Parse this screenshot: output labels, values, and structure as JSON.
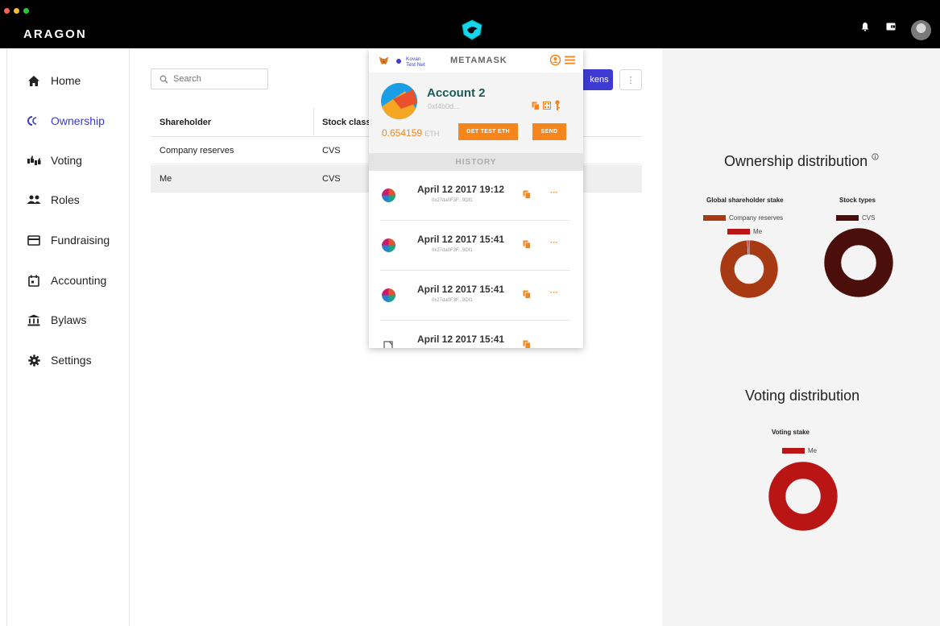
{
  "app": {
    "brand": "ARAGON"
  },
  "colors": {
    "accent": "#3d3bd1",
    "metamask_orange": "#f6851b",
    "company_reserves": "#a83a13",
    "me": "#b91515",
    "cvs": "#4a0f0a"
  },
  "topbar": {
    "icons": [
      "bell-icon",
      "wallet-icon",
      "avatar"
    ]
  },
  "sidebar": {
    "items": [
      {
        "label": "Home",
        "icon": "home-icon"
      },
      {
        "label": "Ownership",
        "icon": "ownership-icon"
      },
      {
        "label": "Voting",
        "icon": "voting-icon"
      },
      {
        "label": "Roles",
        "icon": "roles-icon"
      },
      {
        "label": "Fundraising",
        "icon": "fundraising-icon"
      },
      {
        "label": "Accounting",
        "icon": "accounting-icon"
      },
      {
        "label": "Bylaws",
        "icon": "bylaws-icon"
      },
      {
        "label": "Settings",
        "icon": "settings-icon"
      }
    ],
    "active": "Ownership"
  },
  "main": {
    "search": {
      "placeholder": "Search"
    },
    "tokens_button": "kens",
    "more_button": "⋮",
    "table": {
      "headers": [
        "Shareholder",
        "Stock class"
      ],
      "rows": [
        {
          "shareholder": "Company reserves",
          "stock_class": "CVS"
        },
        {
          "shareholder": "Me",
          "stock_class": "CVS"
        }
      ]
    }
  },
  "ownership": {
    "title": "Ownership distribution",
    "global_stake": {
      "title": "Global shareholder stake",
      "legend": [
        "Company reserves",
        "Me"
      ]
    },
    "stock_types": {
      "title": "Stock types",
      "legend": [
        "CVS"
      ]
    }
  },
  "voting": {
    "title": "Voting distribution",
    "stake": {
      "title": "Voting stake",
      "legend": [
        "Me"
      ]
    }
  },
  "chart_data": [
    {
      "type": "pie",
      "title": "Global shareholder stake",
      "categories": [
        "Company reserves",
        "Me"
      ],
      "values": [
        99,
        1
      ]
    },
    {
      "type": "pie",
      "title": "Stock types",
      "categories": [
        "CVS"
      ],
      "values": [
        100
      ]
    },
    {
      "type": "pie",
      "title": "Voting stake",
      "categories": [
        "Me"
      ],
      "values": [
        100
      ]
    }
  ],
  "metamask": {
    "network": [
      "Kovan",
      "Test Net"
    ],
    "title": "METAMASK",
    "account": {
      "name": "Account 2",
      "address": "0xf4b0d...",
      "balance": "0.654159",
      "unit": "ETH"
    },
    "buttons": {
      "get_test_eth": "GET TEST ETH",
      "send": "SEND"
    },
    "history_label": "HISTORY",
    "transactions": [
      {
        "date": "April 12 2017 19:12",
        "hash": "0x27da0F3F...9Df1"
      },
      {
        "date": "April 12 2017 15:41",
        "hash": "0x27da0F3F...9Df1"
      },
      {
        "date": "April 12 2017 15:41",
        "hash": "0x27da0F3F...9Df1"
      },
      {
        "date": "April 12 2017 15:41",
        "hash": ""
      }
    ]
  }
}
